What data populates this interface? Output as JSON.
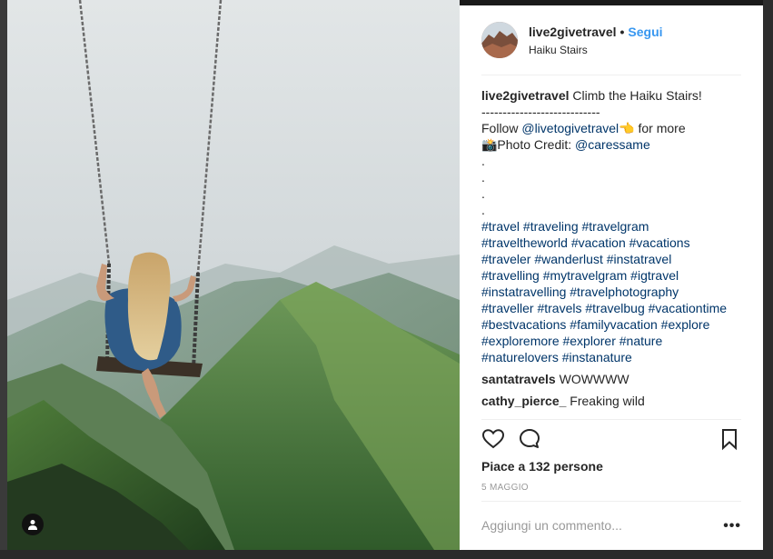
{
  "post": {
    "username": "live2givetravel",
    "follow_label": "Segui",
    "location": "Haiku Stairs",
    "caption": {
      "username": "live2givetravel",
      "title": "Climb the Haiku Stairs!",
      "divider": "----------------------------",
      "follow_prefix": "Follow",
      "follow_handle": "@livetogivetravel",
      "follow_suffix": "👈 for more",
      "credit_prefix": "📸Photo Credit:",
      "credit_handle": "@caressame",
      "dots": [
        ".",
        ".",
        ".",
        "."
      ],
      "hashtag_lines": [
        "#travel #traveling #travelgram",
        "#traveltheworld #vacation #vacations",
        "#traveler #wanderlust #instatravel",
        "#travelling #mytravelgram #igtravel",
        "#instatravelling #travelphotography",
        "#traveller #travels #travelbug #vacationtime",
        "#bestvacations #familyvacation #explore",
        "#exploremore #explorer #nature",
        "#naturelovers #instanature"
      ]
    },
    "comments": [
      {
        "user": "santatravels",
        "text": "WOWWWW"
      },
      {
        "user": "cathy_pierce_",
        "text": "Freaking wild"
      }
    ],
    "likes_text": "Piace a 132 persone",
    "date": "5 MAGGIO",
    "comment_placeholder": "Aggiungi un commento...",
    "more_label": "•••"
  },
  "icons": {
    "like": "heart-icon",
    "comment": "comment-bubble-icon",
    "save": "bookmark-icon",
    "tag": "user-tag-icon"
  },
  "colors": {
    "link": "#003569",
    "follow": "#3897f0",
    "text": "#262626",
    "muted": "#999999"
  }
}
